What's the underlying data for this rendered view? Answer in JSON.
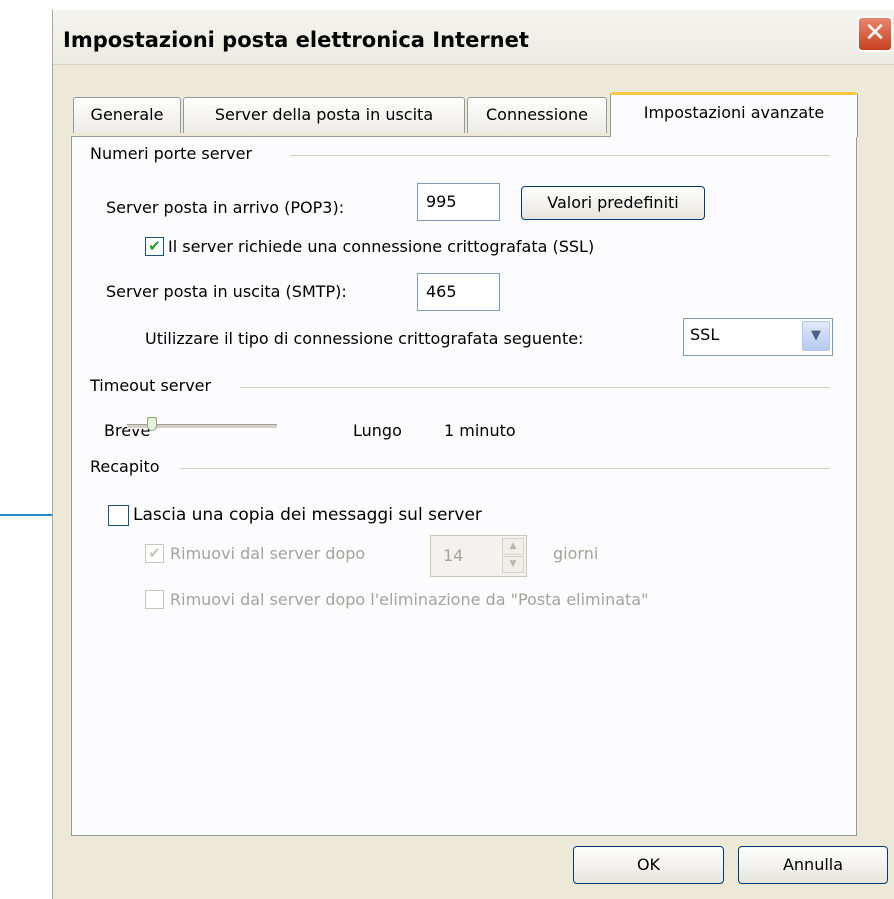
{
  "window": {
    "title": "Impostazioni posta elettronica Internet",
    "close_glyph": "✕"
  },
  "tabs": [
    {
      "label": "Generale",
      "active": false
    },
    {
      "label": "Server della posta in uscita",
      "active": false
    },
    {
      "label": "Connessione",
      "active": false
    },
    {
      "label": "Impostazioni avanzate",
      "active": true
    }
  ],
  "ports": {
    "group_label": "Numeri porte server",
    "incoming_label": "Server posta in arrivo (POP3):",
    "incoming_value": "995",
    "defaults_button": "Valori predefiniti",
    "ssl_required_label": "Il server richiede una connessione crittografata (SSL)",
    "ssl_required_checked": true,
    "outgoing_label": "Server posta in uscita (SMTP):",
    "outgoing_value": "465",
    "encryption_label": "Utilizzare il tipo di connessione crittografata seguente:",
    "encryption_value": "SSL"
  },
  "timeout": {
    "group_label": "Timeout server",
    "short_label": "Breve",
    "long_label": "Lungo",
    "value_label": "1 minuto",
    "slider_fraction": 0.05
  },
  "delivery": {
    "group_label": "Recapito",
    "leave_copy_label": "Lascia una copia dei messaggi sul server",
    "leave_copy_checked": false,
    "remove_after_label": "Rimuovi dal server dopo",
    "remove_after_checked": true,
    "remove_after_days": "14",
    "days_unit": "giorni",
    "remove_on_delete_label": "Rimuovi dal server dopo l'eliminazione da \"Posta eliminata\"",
    "remove_on_delete_checked": false
  },
  "footer": {
    "ok_button": "OK",
    "cancel_button": "Annulla"
  },
  "icons": {
    "checkmark": "✔",
    "dropdown": "▼",
    "spin_up": "▲",
    "spin_down": "▼"
  },
  "colors": {
    "dialog_bg": "#ece9d8",
    "active_tab_accent": "#ffc83c",
    "annotation_arrow": "#1e88d0",
    "close_button": "#c8401d"
  }
}
